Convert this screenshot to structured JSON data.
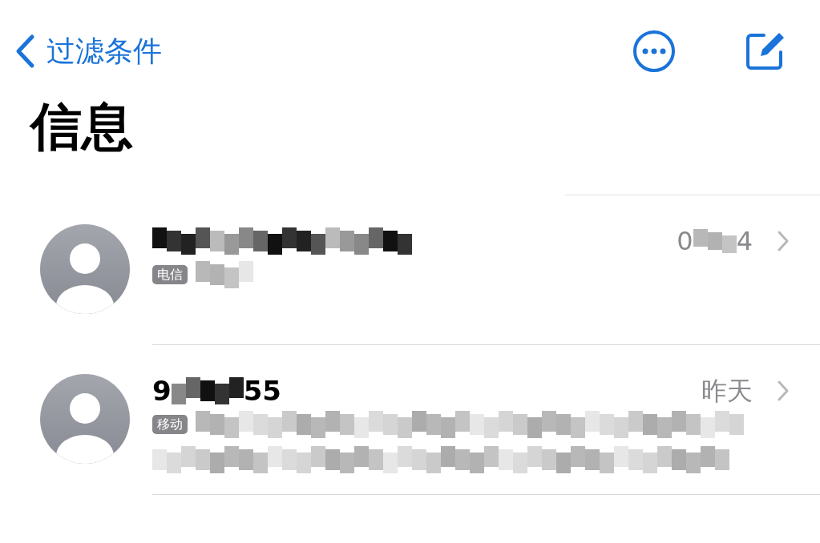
{
  "nav": {
    "back_label": "过滤条件"
  },
  "title": "信息",
  "conversations": [
    {
      "sender": [
        {
          "kind": "redacted"
        }
      ],
      "time": [
        {
          "kind": "text",
          "text": "0"
        },
        {
          "kind": "redacted"
        },
        {
          "kind": "text",
          "text": "4"
        }
      ],
      "carrier": "电信",
      "preview_lines": [
        [
          {
            "kind": "redacted"
          }
        ]
      ]
    },
    {
      "sender": [
        {
          "kind": "text",
          "text": "9"
        },
        {
          "kind": "redacted"
        },
        {
          "kind": "text",
          "text": "55"
        }
      ],
      "time": [
        {
          "kind": "text",
          "text": "昨天"
        }
      ],
      "carrier": "移动",
      "preview_lines": [
        [
          {
            "kind": "redacted"
          }
        ],
        [
          {
            "kind": "redacted"
          }
        ]
      ]
    }
  ]
}
